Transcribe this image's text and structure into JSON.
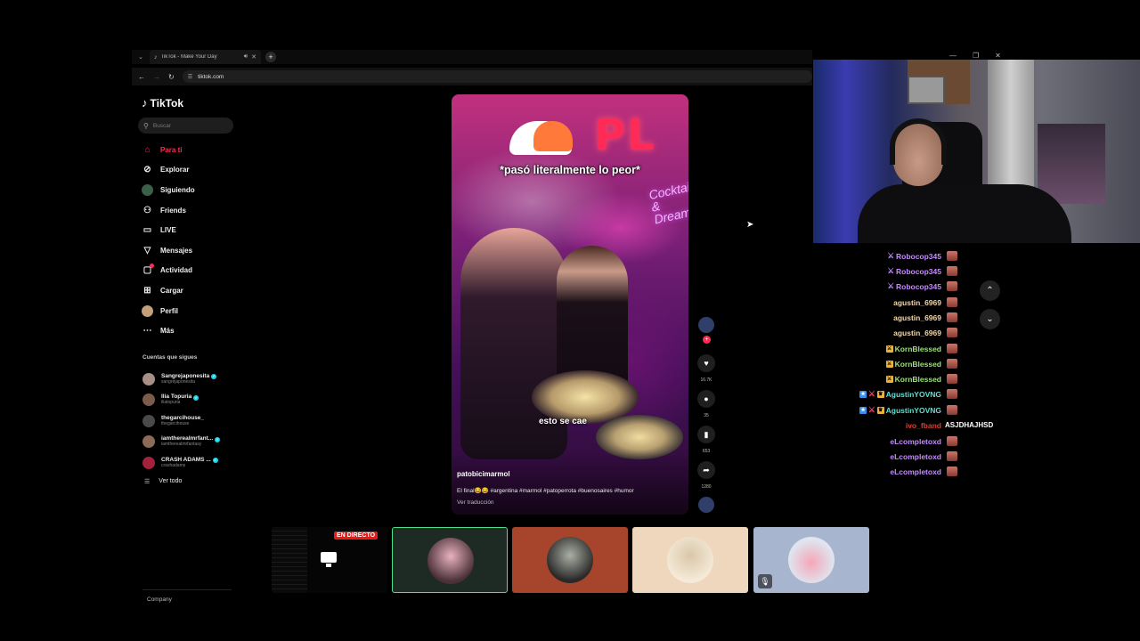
{
  "browser": {
    "tab_title": "TikTok - Make Your Day",
    "tab_favicon": "tiktok-icon",
    "new_tab": "+",
    "url": "tiktok.com"
  },
  "tiktok": {
    "logo_text": "TikTok",
    "search_placeholder": "Buscar",
    "nav": [
      {
        "label": "Para ti",
        "icon": "home-icon"
      },
      {
        "label": "Explorar",
        "icon": "compass-icon"
      },
      {
        "label": "Siguiendo",
        "icon": "following-avatar"
      },
      {
        "label": "Friends",
        "icon": "friends-icon"
      },
      {
        "label": "LIVE",
        "icon": "live-icon"
      },
      {
        "label": "Mensajes",
        "icon": "send-icon"
      },
      {
        "label": "Actividad",
        "icon": "activity-icon"
      },
      {
        "label": "Cargar",
        "icon": "upload-icon"
      },
      {
        "label": "Perfil",
        "icon": "profile-avatar"
      },
      {
        "label": "Más",
        "icon": "more-icon"
      }
    ],
    "following_title": "Cuentas que sigues",
    "following": [
      {
        "name": "Sangrejaponesita",
        "handle": "sangrejaponesita",
        "verified": true
      },
      {
        "name": "Ilia Topuria",
        "handle": "iliatopuria",
        "verified": true
      },
      {
        "name": "thegarcihouse_",
        "handle": "thegarcihouse",
        "verified": false
      },
      {
        "name": "iamtherealmrfant...",
        "handle": "iamtherealmrfantasy",
        "verified": true
      },
      {
        "name": "CRASH ADAMS ...",
        "handle": "crashadams",
        "verified": true
      }
    ],
    "see_all": "Ver todo",
    "company": "Company"
  },
  "video": {
    "caption_top": "*pasó literalmente lo peor*",
    "caption_mid": "esto se cae",
    "sign_text": "PL",
    "sign_script": "Cocktails & Dreams",
    "author": "patobicimarmol",
    "description": "El final😂😂 #argentina #marmol #patoperrota #buenosaires #humor",
    "translate": "Ver traducción",
    "likes": "16.7K",
    "comments": "35",
    "saves": "653",
    "shares": "1280"
  },
  "chat": {
    "messages": [
      {
        "user": "Robocop345",
        "color": "#c38bff",
        "badges": [
          "sword"
        ]
      },
      {
        "user": "Robocop345",
        "color": "#c38bff",
        "badges": [
          "sword"
        ]
      },
      {
        "user": "Robocop345",
        "color": "#c38bff",
        "badges": [
          "sword"
        ]
      },
      {
        "user": "agustin_6969",
        "color": "#f2d6a8",
        "badges": []
      },
      {
        "user": "agustin_6969",
        "color": "#f2d6a8",
        "badges": []
      },
      {
        "user": "agustin_6969",
        "color": "#f2d6a8",
        "badges": []
      },
      {
        "user": "KornBlessed",
        "color": "#9be37a",
        "badges": [
          "sword"
        ]
      },
      {
        "user": "KornBlessed",
        "color": "#9be37a",
        "badges": [
          "sword"
        ]
      },
      {
        "user": "KornBlessed",
        "color": "#9be37a",
        "badges": [
          "sword"
        ]
      },
      {
        "user": "AgustinYOVNG",
        "color": "#5fe0d0",
        "badges": [
          "sub",
          "mod",
          "gold"
        ]
      },
      {
        "user": "AgustinYOVNG",
        "color": "#5fe0d0",
        "badges": [
          "sub",
          "mod",
          "gold"
        ]
      },
      {
        "user": "ivo_fband",
        "color": "#e3392f",
        "badges": [],
        "text": "ASJDHAJHSD"
      },
      {
        "user": "eLcompletoxd",
        "color": "#c38bff",
        "badges": []
      },
      {
        "user": "eLcompletoxd",
        "color": "#c38bff",
        "badges": []
      },
      {
        "user": "eLcompletoxd",
        "color": "#c38bff",
        "badges": []
      }
    ]
  },
  "participants": {
    "live_badge": "EN DIRECTO"
  },
  "colors": {
    "accent": "#fe2c55",
    "verified": "#20d5ec",
    "speaking": "#4ee08a"
  }
}
